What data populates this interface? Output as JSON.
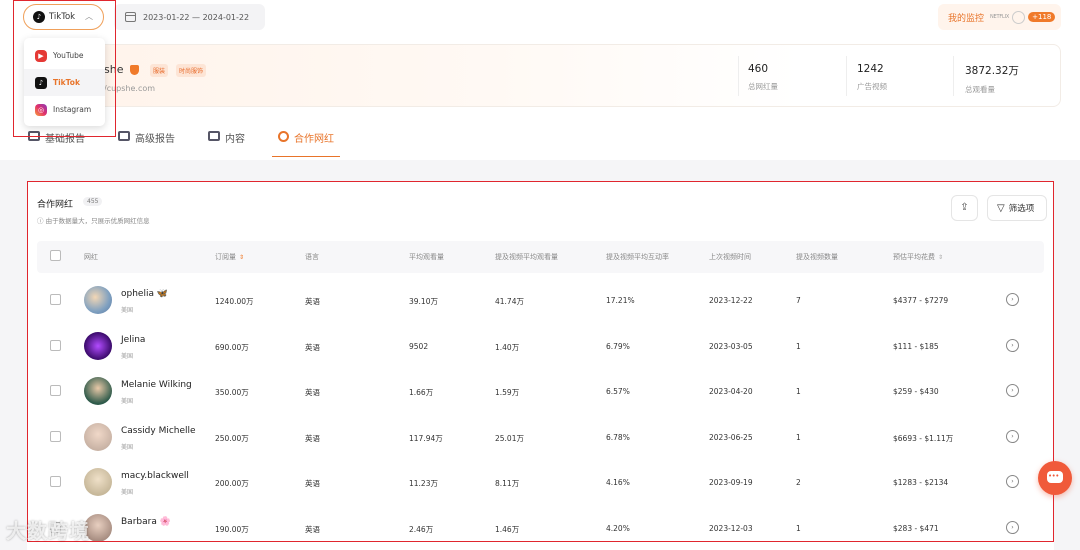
{
  "header": {
    "platform_selected": "TikTok",
    "date_range": "2023-01-22 — 2024-01-22",
    "monitor_label": "我的监控",
    "monitor_logos_text": "NETFLIX",
    "monitor_plus": "+118"
  },
  "platform_menu": [
    {
      "label": "YouTube",
      "icon": "youtube-icon"
    },
    {
      "label": "TikTok",
      "icon": "tiktok-icon"
    },
    {
      "label": "Instagram",
      "icon": "instagram-icon"
    }
  ],
  "brand": {
    "name": "she",
    "tags": [
      "服装",
      "时尚服饰"
    ],
    "url": "/cupshe.com",
    "stats": [
      {
        "value": "460",
        "label": "总网红量"
      },
      {
        "value": "1242",
        "label": "广告视频"
      },
      {
        "value": "3872.32万",
        "label": "总观看量"
      }
    ]
  },
  "tabs": [
    "基础报告",
    "高级报告",
    "内容",
    "合作网红"
  ],
  "panel": {
    "title": "合作网红",
    "count": "455",
    "note": "由于数据量大，只展示优质网红信息",
    "filter_label": "筛选项"
  },
  "table": {
    "headers": [
      "网红",
      "订阅量",
      "语言",
      "平均观看量",
      "提及视频平均观看量",
      "提及视频平均互动率",
      "上次视频时间",
      "提及视频数量",
      "预估平均花费"
    ],
    "rows": [
      {
        "name": "ophelia 🦋",
        "country": "美国",
        "subs": "1240.00万",
        "lang": "英语",
        "avg_views": "39.10万",
        "mention_avg_views": "41.74万",
        "engagement": "17.21%",
        "last_video": "2023-12-22",
        "mentions": "7",
        "cost": "$4377 - $7279"
      },
      {
        "name": "Jelina",
        "country": "美国",
        "subs": "690.00万",
        "lang": "英语",
        "avg_views": "9502",
        "mention_avg_views": "1.40万",
        "engagement": "6.79%",
        "last_video": "2023-03-05",
        "mentions": "1",
        "cost": "$111 - $185"
      },
      {
        "name": "Melanie Wilking",
        "country": "美国",
        "subs": "350.00万",
        "lang": "英语",
        "avg_views": "1.66万",
        "mention_avg_views": "1.59万",
        "engagement": "6.57%",
        "last_video": "2023-04-20",
        "mentions": "1",
        "cost": "$259 - $430"
      },
      {
        "name": "Cassidy Michelle",
        "country": "美国",
        "subs": "250.00万",
        "lang": "英语",
        "avg_views": "117.94万",
        "mention_avg_views": "25.01万",
        "engagement": "6.78%",
        "last_video": "2023-06-25",
        "mentions": "1",
        "cost": "$6693 - $1.11万"
      },
      {
        "name": "macy.blackwell",
        "country": "美国",
        "subs": "200.00万",
        "lang": "英语",
        "avg_views": "11.23万",
        "mention_avg_views": "8.11万",
        "engagement": "4.16%",
        "last_video": "2023-09-19",
        "mentions": "2",
        "cost": "$1283 - $2134"
      },
      {
        "name": "Barbara 🌸",
        "country": "",
        "subs": "190.00万",
        "lang": "英语",
        "avg_views": "2.46万",
        "mention_avg_views": "1.46万",
        "engagement": "4.20%",
        "last_video": "2023-12-03",
        "mentions": "1",
        "cost": "$283 - $471"
      }
    ]
  },
  "watermark": "大数跨境",
  "colors": {
    "accent": "#e8742a",
    "highlight_box": "#e0262e"
  }
}
